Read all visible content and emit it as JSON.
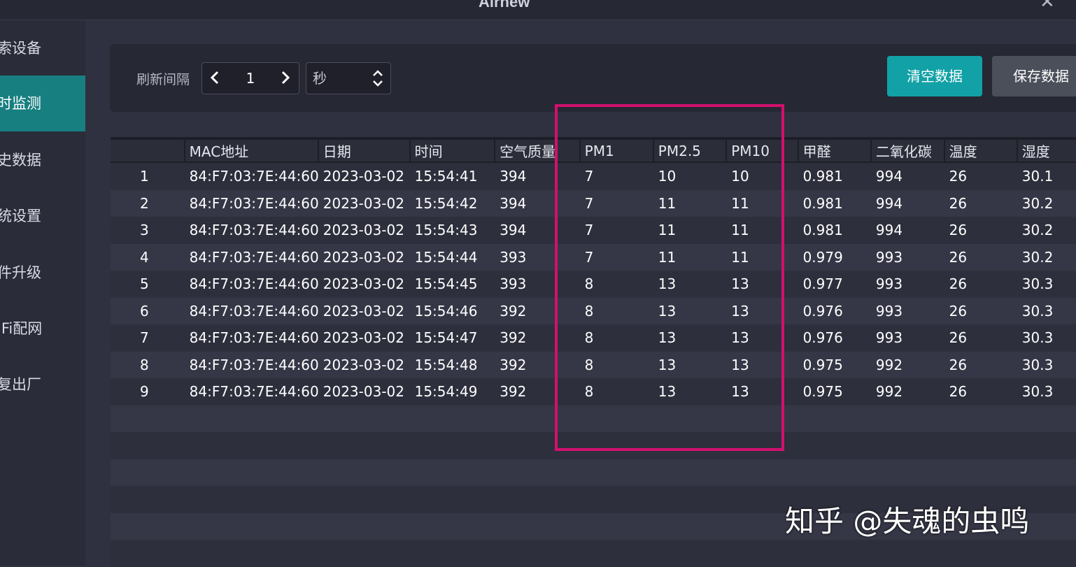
{
  "window": {
    "title": "Airnew"
  },
  "sidebar": {
    "items": [
      {
        "label": "索设备",
        "active": false
      },
      {
        "label": "时监测",
        "active": true
      },
      {
        "label": "史数据",
        "active": false
      },
      {
        "label": "统设置",
        "active": false
      },
      {
        "label": "件升级",
        "active": false
      },
      {
        "label": "iFi配网",
        "active": false
      },
      {
        "label": "复出厂",
        "active": false
      }
    ]
  },
  "toolbar": {
    "interval_label": "刷新间隔",
    "interval_value": "1",
    "unit_value": "秒",
    "clear_label": "清空数据",
    "save_label": "保存数据"
  },
  "table": {
    "columns": [
      "",
      "MAC地址",
      "日期",
      "时间",
      "空气质量",
      "PM1",
      "PM2.5",
      "PM10",
      "甲醛",
      "二氧化碳",
      "温度",
      "湿度"
    ],
    "rows": [
      [
        "1",
        "84:F7:03:7E:44:60",
        "2023-03-02",
        "15:54:41",
        "394",
        "7",
        "10",
        "10",
        "0.981",
        "994",
        "26",
        "30.1"
      ],
      [
        "2",
        "84:F7:03:7E:44:60",
        "2023-03-02",
        "15:54:42",
        "394",
        "7",
        "11",
        "11",
        "0.981",
        "994",
        "26",
        "30.2"
      ],
      [
        "3",
        "84:F7:03:7E:44:60",
        "2023-03-02",
        "15:54:43",
        "394",
        "7",
        "11",
        "11",
        "0.981",
        "994",
        "26",
        "30.2"
      ],
      [
        "4",
        "84:F7:03:7E:44:60",
        "2023-03-02",
        "15:54:44",
        "393",
        "7",
        "11",
        "11",
        "0.979",
        "993",
        "26",
        "30.2"
      ],
      [
        "5",
        "84:F7:03:7E:44:60",
        "2023-03-02",
        "15:54:45",
        "393",
        "8",
        "13",
        "13",
        "0.977",
        "993",
        "26",
        "30.3"
      ],
      [
        "6",
        "84:F7:03:7E:44:60",
        "2023-03-02",
        "15:54:46",
        "392",
        "8",
        "13",
        "13",
        "0.976",
        "993",
        "26",
        "30.3"
      ],
      [
        "7",
        "84:F7:03:7E:44:60",
        "2023-03-02",
        "15:54:47",
        "392",
        "8",
        "13",
        "13",
        "0.976",
        "993",
        "26",
        "30.3"
      ],
      [
        "8",
        "84:F7:03:7E:44:60",
        "2023-03-02",
        "15:54:48",
        "392",
        "8",
        "13",
        "13",
        "0.975",
        "992",
        "26",
        "30.3"
      ],
      [
        "9",
        "84:F7:03:7E:44:60",
        "2023-03-02",
        "15:54:49",
        "392",
        "8",
        "13",
        "13",
        "0.975",
        "992",
        "26",
        "30.3"
      ]
    ],
    "empty_rows": 6
  },
  "watermark": "知乎 @失魂的虫鸣",
  "colors": {
    "accent": "#12a1a6",
    "active_nav": "#187f80",
    "highlight_box": "#d3106e"
  },
  "icons": {
    "decrement": "chevron-left-icon",
    "increment": "chevron-right-icon",
    "select": "updown-icon",
    "close": "close-icon"
  }
}
